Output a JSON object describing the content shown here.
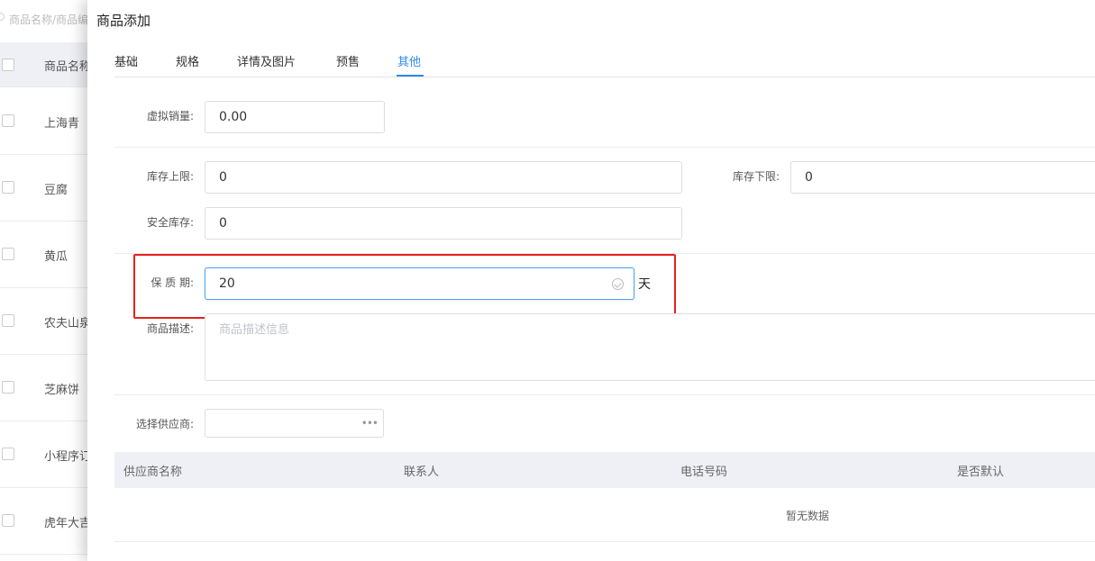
{
  "background_list": {
    "search_placeholder": "商品名称/商品编码",
    "header_label": "商品名称",
    "rows": [
      "上海青",
      "豆腐",
      "黄瓜",
      "农夫山泉",
      "芝麻饼",
      "小程序订",
      "虎年大吉"
    ]
  },
  "drawer": {
    "title": "商品添加",
    "tabs": [
      {
        "label": "基础"
      },
      {
        "label": "规格"
      },
      {
        "label": "详情及图片"
      },
      {
        "label": "预售"
      },
      {
        "label": "其他"
      }
    ],
    "active_tab": "其他",
    "fields": {
      "virtual_sales": {
        "label": "虚拟销量:",
        "value": "0.00"
      },
      "stock_upper": {
        "label": "库存上限:",
        "value": "0"
      },
      "stock_lower": {
        "label": "库存下限:",
        "value": "0"
      },
      "safety_stock": {
        "label": "安全库存:",
        "value": "0"
      },
      "shelf_life": {
        "label": "保 质 期:",
        "value": "20",
        "unit": "天"
      },
      "description": {
        "label": "商品描述:",
        "placeholder": "商品描述信息"
      },
      "supplier": {
        "label": "选择供应商:"
      }
    },
    "supplier_table": {
      "columns": [
        "供应商名称",
        "联系人",
        "电话号码",
        "是否默认"
      ],
      "empty_text": "暂无数据"
    },
    "colors": {
      "accent": "#2d8cf0",
      "highlight": "#e6221d"
    }
  }
}
